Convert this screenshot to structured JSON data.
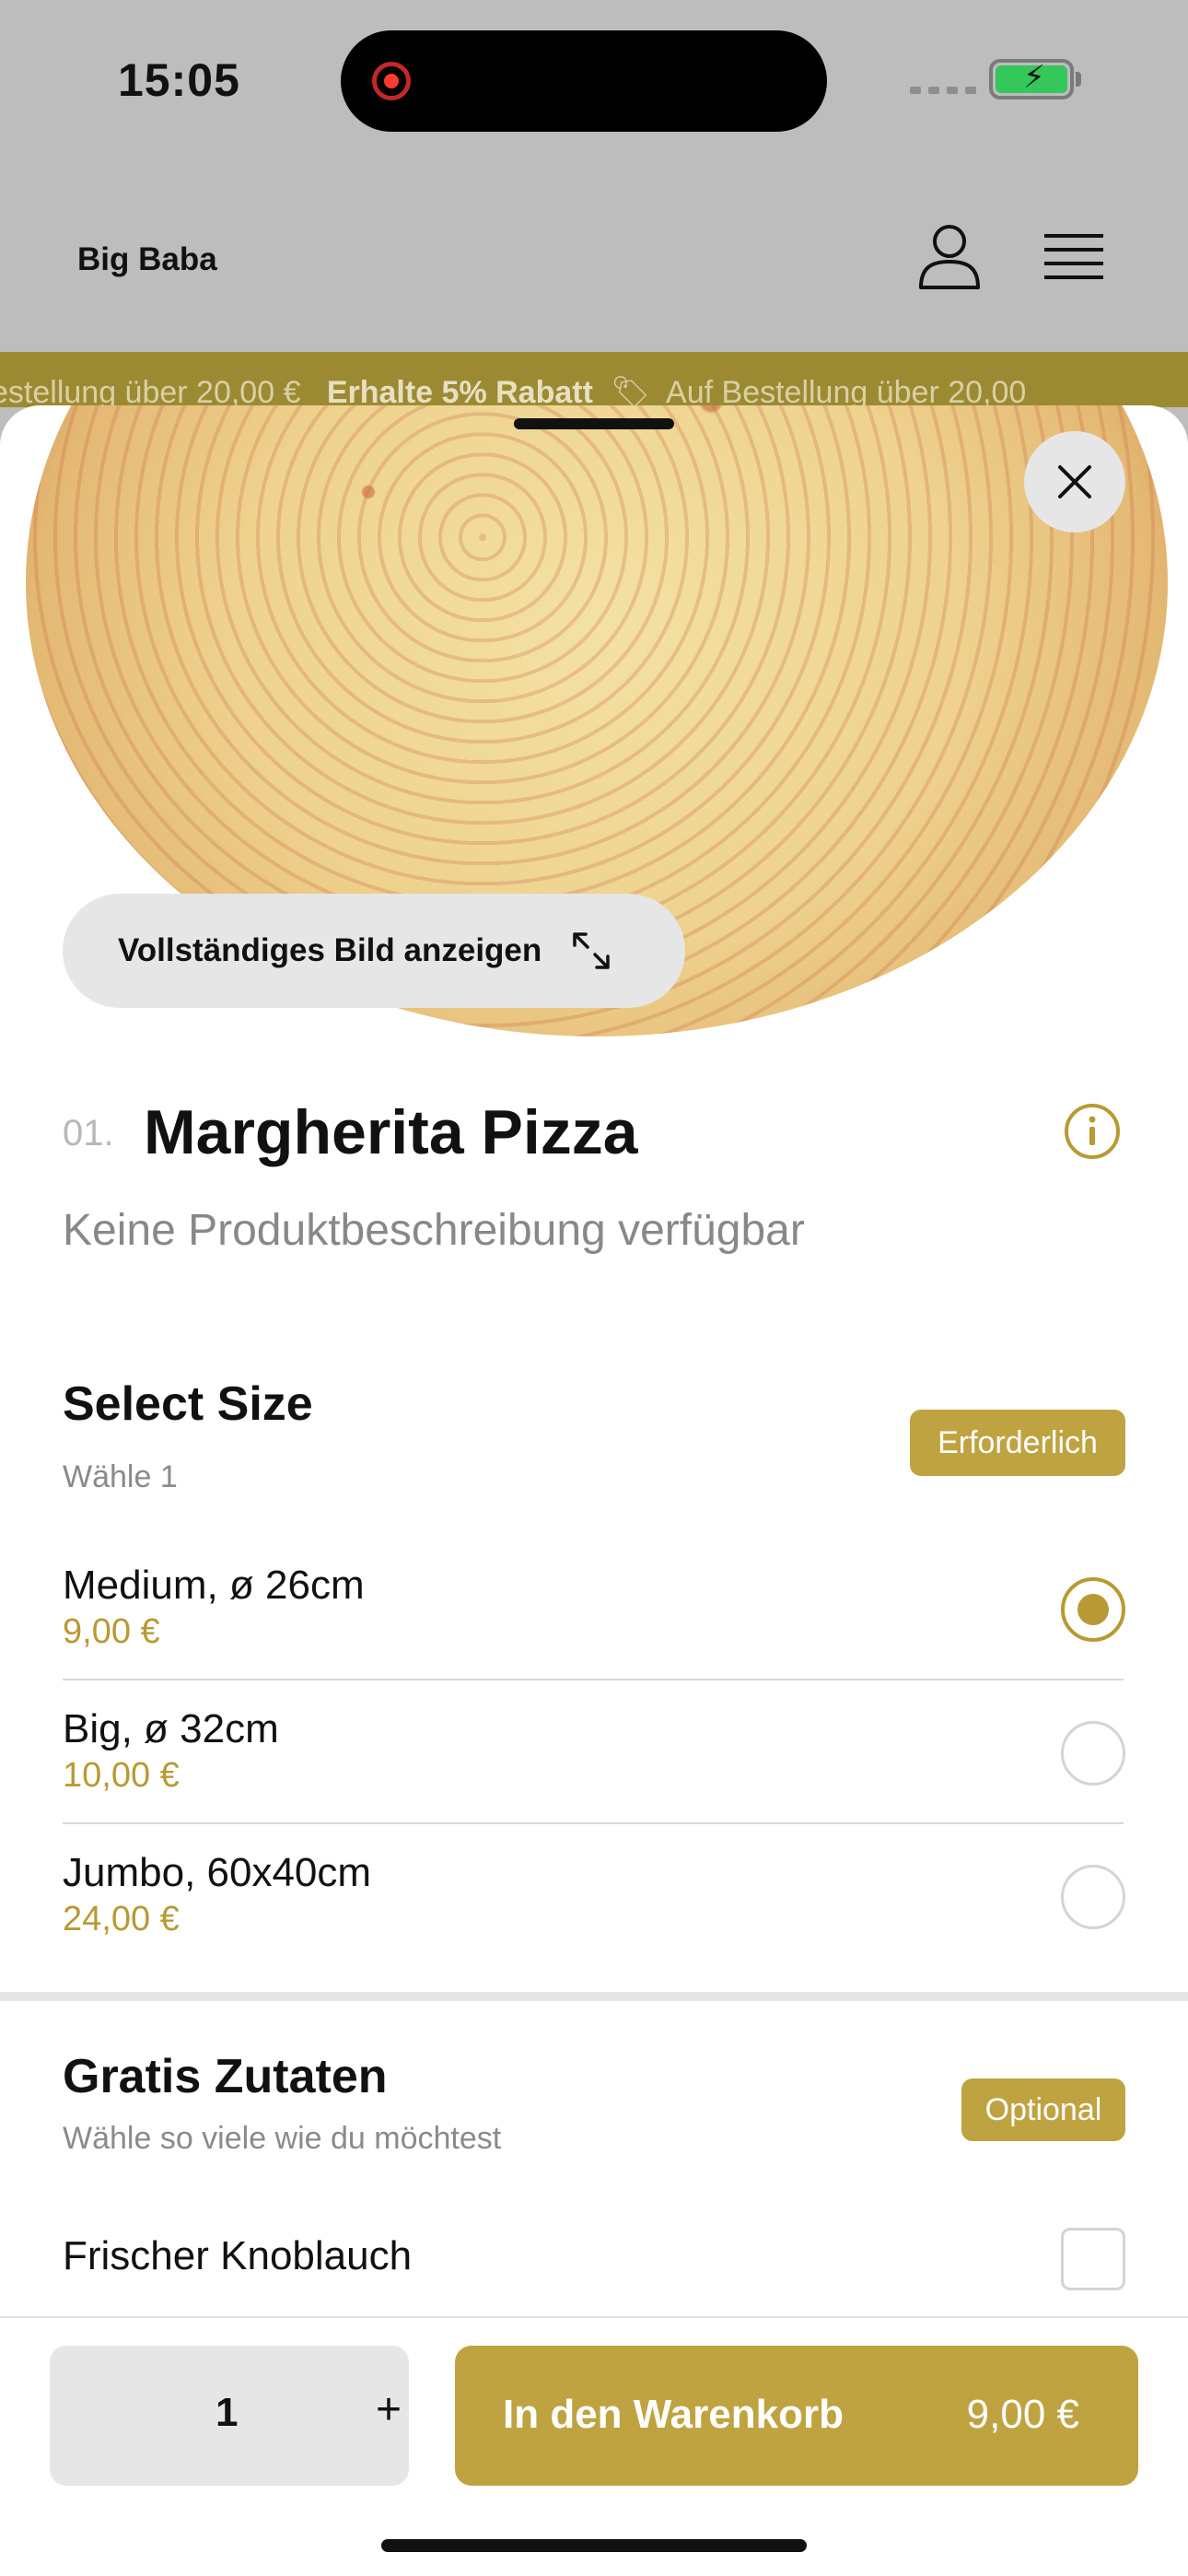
{
  "status_bar": {
    "time": "15:05"
  },
  "header": {
    "brand": "Big Baba"
  },
  "promo": {
    "prefix": "estellung über 20,00 €",
    "highlight": "Erhalte 5% Rabatt",
    "suffix": "Auf Bestellung über 20,00"
  },
  "hero": {
    "full_image_label": "Vollständiges Bild anzeigen"
  },
  "product": {
    "number": "01.",
    "title": "Margherita Pizza",
    "description": "Keine Produktbeschreibung verfügbar"
  },
  "size_section": {
    "title": "Select Size",
    "subtitle": "Wähle 1",
    "badge": "Erforderlich",
    "options": [
      {
        "name": "Medium, ø 26cm",
        "price": "9,00 €",
        "selected": true
      },
      {
        "name": "Big, ø 32cm",
        "price": "10,00 €",
        "selected": false
      },
      {
        "name": "Jumbo, 60x40cm",
        "price": "24,00 €",
        "selected": false
      }
    ]
  },
  "extras_section": {
    "title": "Gratis Zutaten",
    "subtitle": "Wähle so viele wie du möchtest",
    "badge": "Optional",
    "items": [
      {
        "name": "Frischer Knoblauch",
        "checked": false
      }
    ]
  },
  "footer": {
    "quantity": "1",
    "plus": "+",
    "add_label": "In den Warenkorb",
    "add_price": "9,00 €"
  },
  "colors": {
    "accent": "#bfa341",
    "price": "#b89a34",
    "banner": "#9c8a33"
  }
}
